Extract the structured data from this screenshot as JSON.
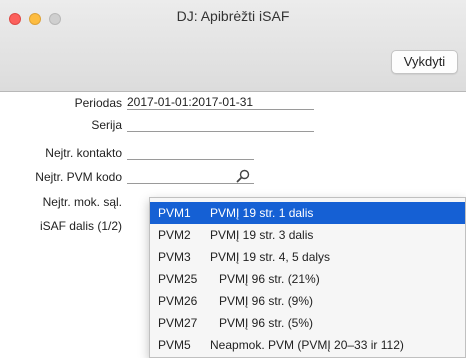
{
  "window": {
    "title": "DJ: Apibrėžti iSAF",
    "execute_button": "Vykdyti"
  },
  "form": {
    "period_label": "Periodas",
    "period_value": "2017-01-01:2017-01-31",
    "series_label": "Serija",
    "series_value": "",
    "contact_label": "Nejtr. kontakto",
    "contact_value": "",
    "vat_code_label": "Nejtr. PVM kodo",
    "vat_code_value": "",
    "payment_label": "Nejtr. mok. sąl.",
    "isaf_part_label": "iSAF dalis (1/2)"
  },
  "dropdown": {
    "options": [
      {
        "code": "PVM1",
        "desc": "PVMĮ 19 str. 1 dalis",
        "selected": true
      },
      {
        "code": "PVM2",
        "desc": "PVMĮ 19 str. 3 dalis",
        "selected": false
      },
      {
        "code": "PVM3",
        "desc": "PVMĮ 19 str. 4, 5 dalys",
        "selected": false
      },
      {
        "code": "PVM25",
        "desc": "PVMĮ 96 str. (21%)",
        "selected": false
      },
      {
        "code": "PVM26",
        "desc": "PVMĮ 96 str. (9%)",
        "selected": false
      },
      {
        "code": "PVM27",
        "desc": "PVMĮ 96 str. (5%)",
        "selected": false
      },
      {
        "code": "PVM5",
        "desc": "Neapmok. PVM (PVMĮ 20–33 ir 112)",
        "selected": false
      }
    ],
    "selected_color": "#1560d4"
  }
}
